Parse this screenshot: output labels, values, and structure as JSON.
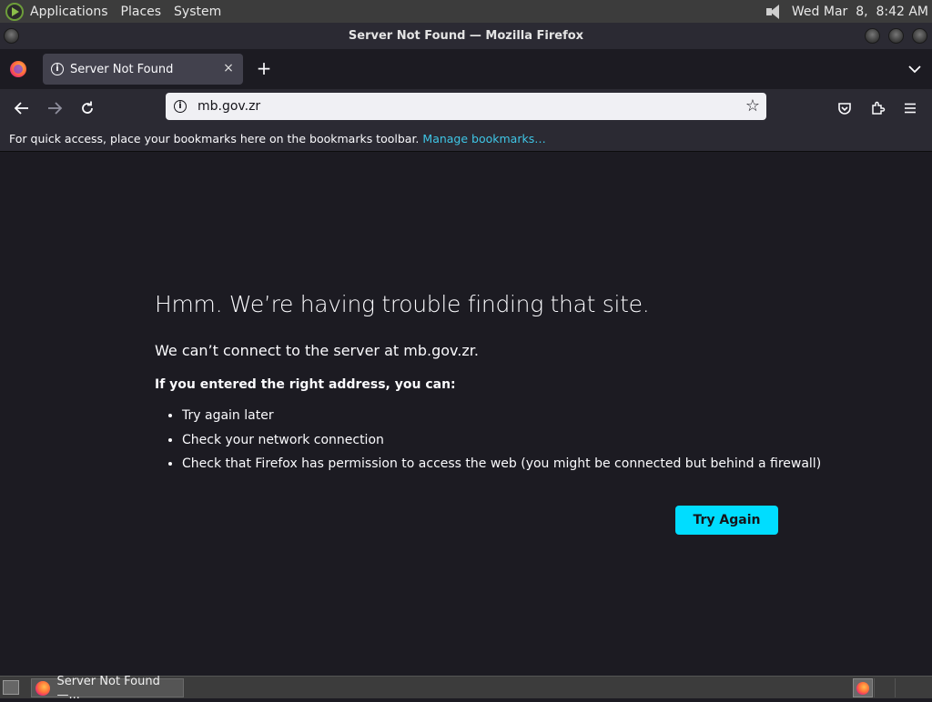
{
  "system_panel": {
    "menus": [
      "Applications",
      "Places",
      "System"
    ],
    "clock": "Wed Mar  8,  8:42 AM"
  },
  "window": {
    "title": "Server Not Found — Mozilla Firefox"
  },
  "tabs": [
    {
      "label": "Server Not Found",
      "close_symbol": "×"
    }
  ],
  "new_tab_symbol": "+",
  "urlbar": {
    "value": "mb.gov.zr"
  },
  "bookmarks_bar": {
    "message": "For quick access, place your bookmarks here on the bookmarks toolbar.",
    "link": "Manage bookmarks…"
  },
  "error_page": {
    "title": "Hmm. We’re having trouble finding that site.",
    "description": "We can’t connect to the server at mb.gov.zr.",
    "subheading": "If you entered the right address, you can:",
    "suggestions": [
      "Try again later",
      "Check your network connection",
      "Check that Firefox has permission to access the web (you might be connected but behind a firewall)"
    ],
    "button": "Try Again"
  },
  "taskbar": {
    "window_label": "Server Not Found —..."
  },
  "colors": {
    "accent": "#00ddff",
    "link": "#3fc6e6",
    "content_bg": "#1c1b22",
    "toolbar_bg": "#2b2a33"
  }
}
